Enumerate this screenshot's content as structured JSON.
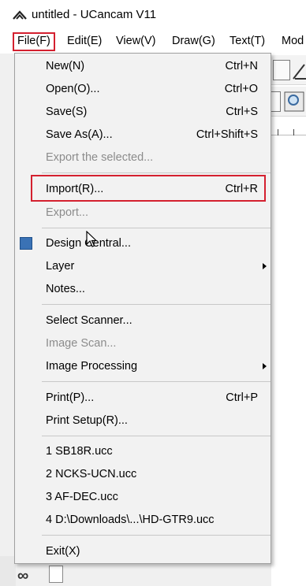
{
  "window": {
    "title": "untitled - UCancam V11"
  },
  "menubar": {
    "items": [
      {
        "label": "File(F)"
      },
      {
        "label": "Edit(E)"
      },
      {
        "label": "View(V)"
      },
      {
        "label": "Draw(G)"
      },
      {
        "label": "Text(T)"
      },
      {
        "label": "Mod"
      }
    ]
  },
  "file_menu": {
    "items": [
      {
        "label": "New(N)",
        "shortcut": "Ctrl+N",
        "enabled": true
      },
      {
        "label": "Open(O)...",
        "shortcut": "Ctrl+O",
        "enabled": true
      },
      {
        "label": "Save(S)",
        "shortcut": "Ctrl+S",
        "enabled": true
      },
      {
        "label": "Save As(A)...",
        "shortcut": "Ctrl+Shift+S",
        "enabled": true
      },
      {
        "label": "Export the selected...",
        "shortcut": "",
        "enabled": false
      },
      {
        "label": "Import(R)...",
        "shortcut": "Ctrl+R",
        "enabled": true,
        "highlighted": true
      },
      {
        "label": "Export...",
        "shortcut": "",
        "enabled": false
      },
      {
        "label": "Design Central...",
        "shortcut": "",
        "enabled": true,
        "icon": "design-central-icon"
      },
      {
        "label": "Layer",
        "shortcut": "",
        "enabled": true,
        "submenu": true
      },
      {
        "label": "Notes...",
        "shortcut": "",
        "enabled": true
      },
      {
        "label": "Select Scanner...",
        "shortcut": "",
        "enabled": true
      },
      {
        "label": "Image Scan...",
        "shortcut": "",
        "enabled": false
      },
      {
        "label": "Image Processing",
        "shortcut": "",
        "enabled": true,
        "submenu": true
      },
      {
        "label": "Print(P)...",
        "shortcut": "Ctrl+P",
        "enabled": true
      },
      {
        "label": "Print Setup(R)...",
        "shortcut": "",
        "enabled": true
      },
      {
        "label": "1 SB18R.ucc",
        "shortcut": "",
        "enabled": true
      },
      {
        "label": "2 NCKS-UCN.ucc",
        "shortcut": "",
        "enabled": true
      },
      {
        "label": "3 AF-DEC.ucc",
        "shortcut": "",
        "enabled": true
      },
      {
        "label": "4 D:\\Downloads\\...\\HD-GTR9.ucc",
        "shortcut": "",
        "enabled": true
      },
      {
        "label": "Exit(X)",
        "shortcut": "",
        "enabled": true
      }
    ]
  },
  "colors": {
    "highlight": "#d4202f",
    "disabled_text": "#8c8c8c",
    "menu_bg": "#f2f2f2"
  }
}
